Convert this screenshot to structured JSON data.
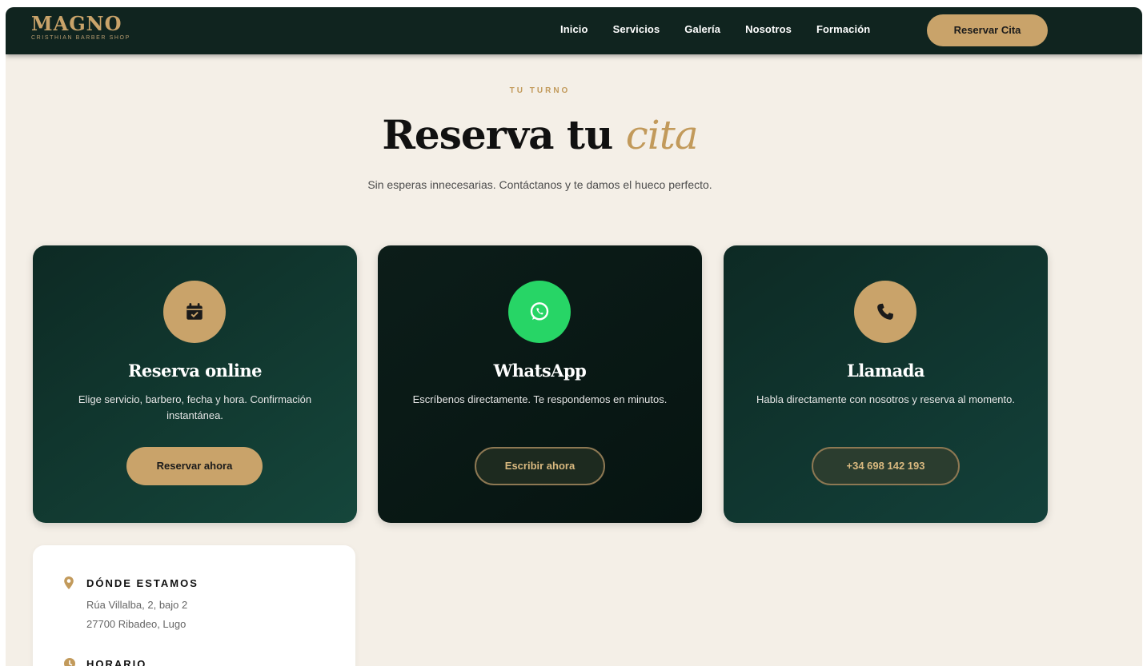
{
  "brand": {
    "name": "MAGNO",
    "tagline": "CRISTHIAN BARBER SHOP"
  },
  "nav": {
    "links": [
      "Inicio",
      "Servicios",
      "Galería",
      "Nosotros",
      "Formación"
    ],
    "cta": "Reservar Cita"
  },
  "hero": {
    "eyebrow": "TU TURNO",
    "title_main": "Reserva tu ",
    "title_accent": "cita",
    "subtitle": "Sin esperas innecesarias. Contáctanos y te damos el hueco perfecto."
  },
  "cards": [
    {
      "icon": "calendar-icon",
      "title": "Reserva online",
      "desc": "Elige servicio, barbero, fecha y hora. Confirmación instantánea.",
      "button": "Reservar ahora"
    },
    {
      "icon": "whatsapp-icon",
      "title": "WhatsApp",
      "desc": "Escríbenos directamente. Te respondemos en minutos.",
      "button": "Escribir ahora"
    },
    {
      "icon": "phone-icon",
      "title": "Llamada",
      "desc": "Habla directamente con nosotros y reserva al momento.",
      "button": "+34 698 142 193"
    }
  ],
  "info": {
    "location_heading": "DÓNDE ESTAMOS",
    "address_line1": "Rúa Villalba, 2, bajo 2",
    "address_line2": "27700 Ribadeo, Lugo",
    "hours_heading": "HORARIO"
  },
  "colors": {
    "accent": "#c9a36a",
    "nav_bg": "#10241f",
    "card_green": "#13413a",
    "whatsapp": "#27d566",
    "page_bg": "#f4efe7"
  }
}
